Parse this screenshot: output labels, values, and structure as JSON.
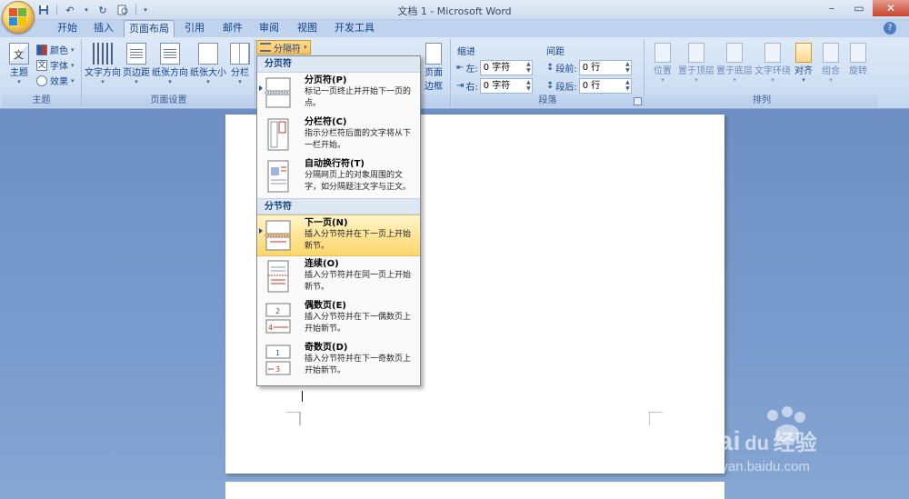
{
  "window": {
    "title": "文档 1 - Microsoft Word"
  },
  "tabs": [
    "开始",
    "插入",
    "页面布局",
    "引用",
    "邮件",
    "审阅",
    "视图",
    "开发工具"
  ],
  "ribbon": {
    "theme_group": {
      "label": "主题",
      "theme_btn": "主题",
      "colors": "颜色",
      "fonts": "字体",
      "effects": "效果"
    },
    "page_setup_group": {
      "label": "页面设置",
      "text_direction": "文字方向",
      "margins": "页边距",
      "orientation": "纸张方向",
      "size": "纸张大小",
      "columns": "分栏",
      "breaks": "分隔符"
    },
    "page_bg": {
      "page_border": "页面",
      "page_border2": "边框"
    },
    "paragraph_group": {
      "label": "段落",
      "indent_title": "缩进",
      "spacing_title": "间距",
      "left_label": "左:",
      "left_value": "0 字符",
      "right_label": "右:",
      "right_value": "0 字符",
      "before_label": "段前:",
      "before_value": "0 行",
      "after_label": "段后:",
      "after_value": "0 行"
    },
    "arrange_group": {
      "label": "排列",
      "position": "位置",
      "bring_front": "置于顶层",
      "send_back": "置于底层",
      "text_wrap": "文字环绕",
      "align": "对齐",
      "group": "组合",
      "rotate": "旋转"
    }
  },
  "breaks_menu": {
    "page_breaks_header": "分页符",
    "section_breaks_header": "分节符",
    "items": [
      {
        "title": "分页符(P)",
        "desc": "标记一页终止并开始下一页的点。"
      },
      {
        "title": "分栏符(C)",
        "desc": "指示分栏符后面的文字将从下一栏开始。"
      },
      {
        "title": "自动换行符(T)",
        "desc": "分隔网页上的对象周围的文字，如分隔题注文字与正文。"
      },
      {
        "title": "下一页(N)",
        "desc": "插入分节符并在下一页上开始新节。"
      },
      {
        "title": "连续(O)",
        "desc": "插入分节符并在同一页上开始新节。"
      },
      {
        "title": "偶数页(E)",
        "desc": "插入分节符并在下一偶数页上开始新节。"
      },
      {
        "title": "奇数页(D)",
        "desc": "插入分节符并在下一奇数页上开始新节。"
      }
    ]
  },
  "watermark": {
    "brand": "Bai",
    "brand_tail": "经验",
    "du": "du",
    "url": "jingyan.baidu.com"
  }
}
